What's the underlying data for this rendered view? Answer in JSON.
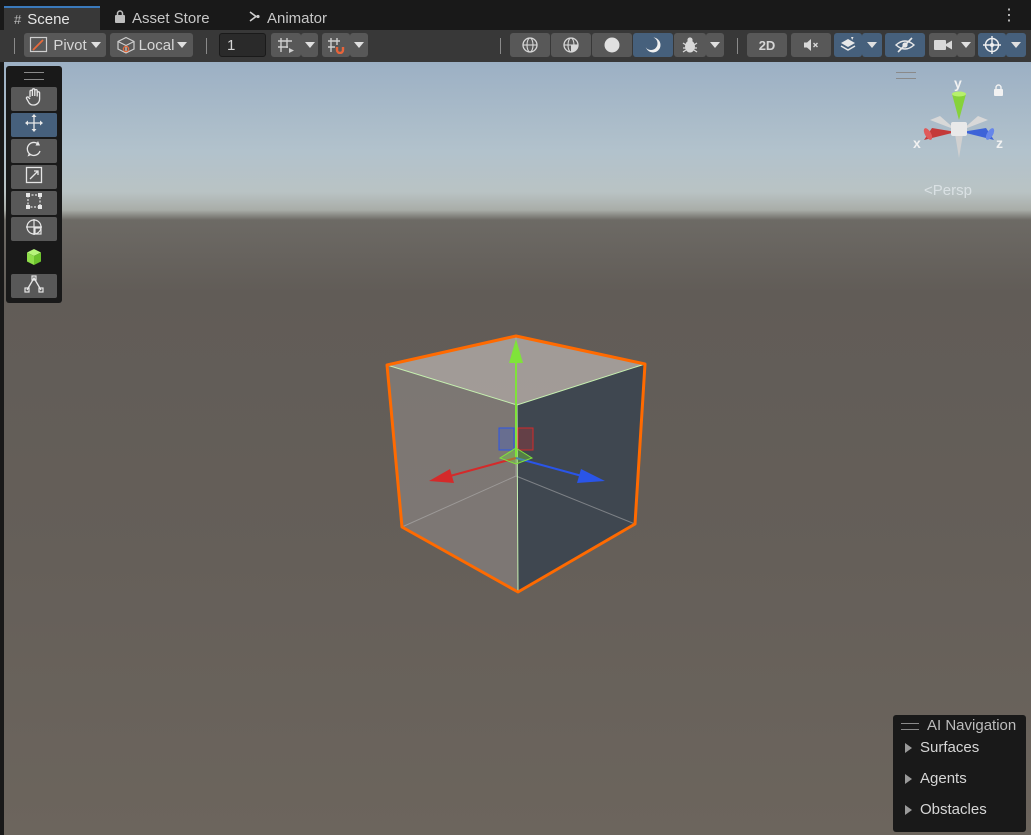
{
  "tabs": [
    {
      "icon": "grid-icon",
      "label": "Scene",
      "active": true
    },
    {
      "icon": "lock-bag-icon",
      "label": "Asset Store",
      "active": false
    },
    {
      "icon": "animator-icon",
      "label": "Animator",
      "active": false
    }
  ],
  "toolbar": {
    "pivot_label": "Pivot",
    "local_label": "Local",
    "grid_snap_value": "1",
    "mode_2d_label": "2D"
  },
  "tools": [
    {
      "name": "hand-tool",
      "icon": "hand-icon",
      "selected": false
    },
    {
      "name": "move-tool",
      "icon": "move-arrows-icon",
      "selected": true
    },
    {
      "name": "rotate-tool",
      "icon": "rotate-icon",
      "selected": false
    },
    {
      "name": "scale-tool",
      "icon": "scale-icon",
      "selected": false
    },
    {
      "name": "rect-tool",
      "icon": "rect-transform-icon",
      "selected": false
    },
    {
      "name": "transform-tool",
      "icon": "transform-icon",
      "selected": false
    },
    {
      "name": "custom-tool",
      "icon": "green-cube-icon",
      "selected": false
    },
    {
      "name": "probe-tool",
      "icon": "probe-icon",
      "selected": false
    }
  ],
  "gizmo": {
    "x_label": "x",
    "y_label": "y",
    "z_label": "z",
    "projection_label": "Persp"
  },
  "ai_navigation": {
    "title": "AI Navigation",
    "items": [
      "Surfaces",
      "Agents",
      "Obstacles"
    ]
  },
  "colors": {
    "selection_outline": "#ff6a00",
    "axis_x": "#d42a2a",
    "axis_y": "#7fe33a",
    "axis_z": "#2a55e8",
    "accent_blue": "#46607c"
  }
}
